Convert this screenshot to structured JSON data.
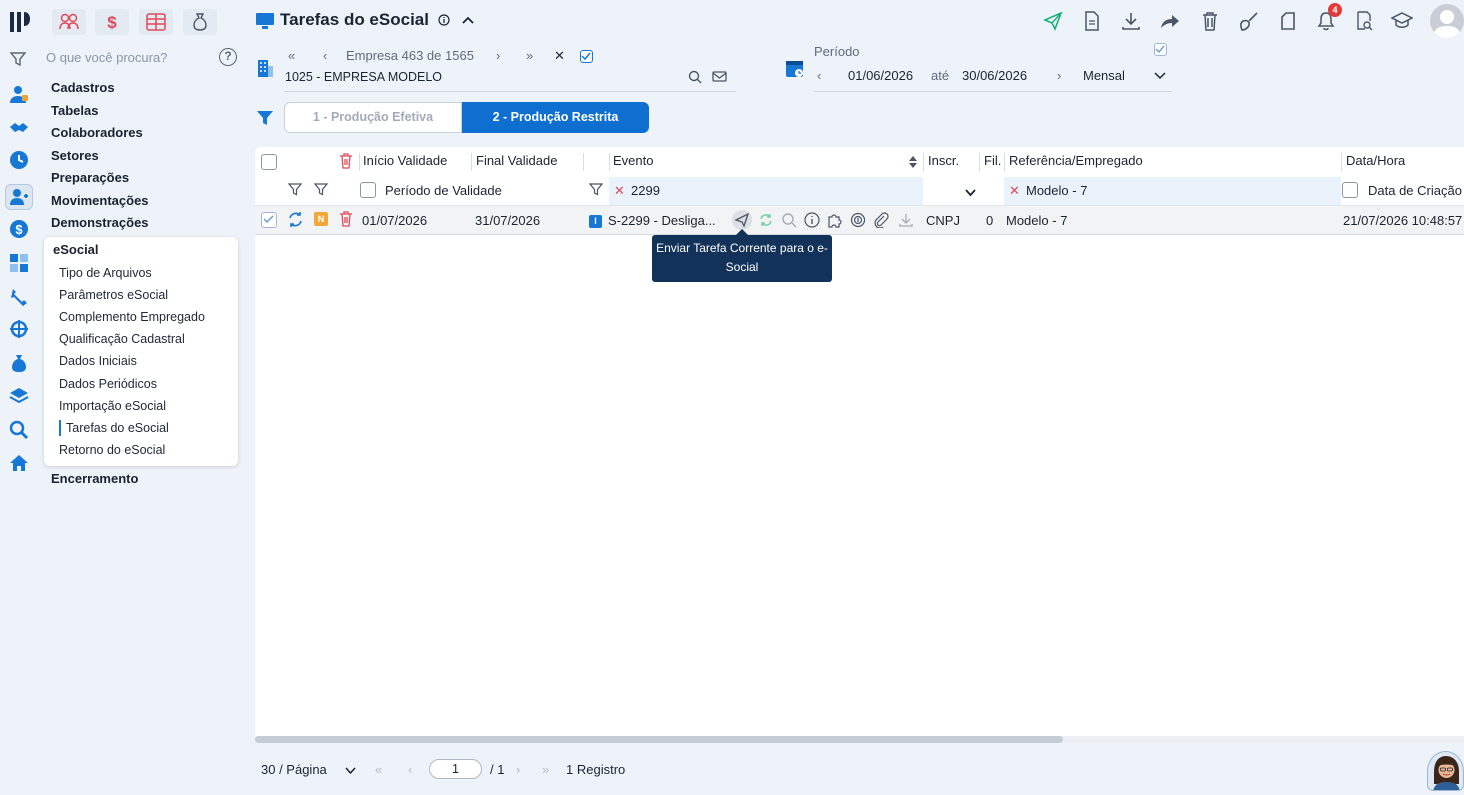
{
  "search": {
    "placeholder": "O que você procura?",
    "help": "?"
  },
  "menu": {
    "items": [
      "Cadastros",
      "Tabelas",
      "Colaboradores",
      "Setores",
      "Preparações",
      "Movimentações",
      "Demonstrações"
    ],
    "submenu_title": "eSocial",
    "submenu": [
      "Tipo de Arquivos",
      "Parâmetros eSocial",
      "Complemento Empregado",
      "Qualificação Cadastral",
      "Dados Iniciais",
      "Dados Periódicos",
      "Importação eSocial",
      "Tarefas do eSocial",
      "Retorno do eSocial"
    ],
    "active": "Tarefas do eSocial",
    "last": "Encerramento"
  },
  "header": {
    "title": "Tarefas do eSocial",
    "notifications": "4"
  },
  "company": {
    "nav_label": "Empresa 463 de 1565",
    "name": "1025 - EMPRESA MODELO"
  },
  "period": {
    "label": "Período",
    "start": "01/06/2026",
    "sep": "até",
    "end": "30/06/2026",
    "mode": "Mensal"
  },
  "tabs": [
    {
      "label": "1 - Produção Efetiva",
      "active": false
    },
    {
      "label": "2 - Produção Restrita",
      "active": true
    }
  ],
  "grid": {
    "headers": {
      "inicio": "Início Validade",
      "final": "Final Validade",
      "evento": "Evento",
      "inscr": "Inscr.",
      "fil": "Fil.",
      "referencia": "Referência/Empregado",
      "datahora": "Data/Hora"
    },
    "filters": {
      "periodo": "Período de Validade",
      "evento": "2299",
      "referencia": "Modelo - 7",
      "data": "Data de Criação"
    },
    "rows": [
      {
        "status_badge": "N",
        "inicio": "01/07/2026",
        "final": "31/07/2026",
        "evento_badge": "I",
        "evento": "S-2299 - Desliga...",
        "inscr": "CNPJ",
        "fil": "0",
        "referencia": "Modelo - 7",
        "datahora": "21/07/2026 10:48:57"
      }
    ],
    "tooltip": "Enviar Tarefa Corrente para o e-Social"
  },
  "pager": {
    "per_page": "30 / Página",
    "page": "1",
    "total_pages": "/ 1",
    "records": "1 Registro"
  },
  "colors": {
    "accent": "#0f6fd1",
    "tooltip": "#13325a",
    "danger": "#e03b3b",
    "send": "#1bb07a"
  }
}
